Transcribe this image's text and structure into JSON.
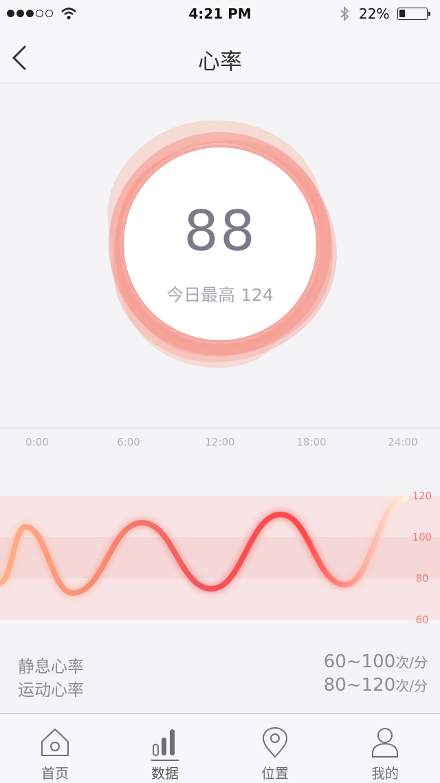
{
  "status": {
    "time": "4:21 PM",
    "battery_pct": "22%",
    "battery_level": 0.22
  },
  "nav": {
    "title": "心率"
  },
  "heart_rate": {
    "current": "88",
    "max_label": "今日最高 124"
  },
  "chart_data": {
    "type": "line",
    "x_ticks": [
      "0:00",
      "6:00",
      "12:00",
      "18:00",
      "24:00"
    ],
    "y_ticks": [
      "120",
      "100",
      "80",
      "60"
    ],
    "ylim": [
      60,
      120
    ],
    "bands": [
      {
        "name": "静息心率",
        "range": [
          60,
          100
        ]
      },
      {
        "name": "运动心率",
        "range": [
          80,
          120
        ]
      }
    ],
    "series": [
      {
        "x": [
          0,
          1.5,
          4.3,
          8.4,
          12.5,
          16.6,
          20.4,
          24
        ],
        "values": [
          78,
          105,
          73,
          107,
          75,
          111,
          77,
          119
        ]
      }
    ],
    "gradient": [
      "#ffb08a",
      "#f98a72",
      "#f2545a",
      "#ff4a4a",
      "#fff2dc"
    ]
  },
  "legend": {
    "resting_label": "静息心率",
    "resting_value": "60~100",
    "exercise_label": "运动心率",
    "exercise_value": "80~120",
    "unit": "次/分"
  },
  "tabs": [
    {
      "label": "首页",
      "icon": "home-icon"
    },
    {
      "label": "数据",
      "icon": "bar-chart-icon"
    },
    {
      "label": "位置",
      "icon": "location-pin-icon"
    },
    {
      "label": "我的",
      "icon": "user-icon"
    }
  ],
  "colors": {
    "accent": "#f2545a",
    "band": "#f7d5d6",
    "text_muted": "#8e8e94"
  }
}
